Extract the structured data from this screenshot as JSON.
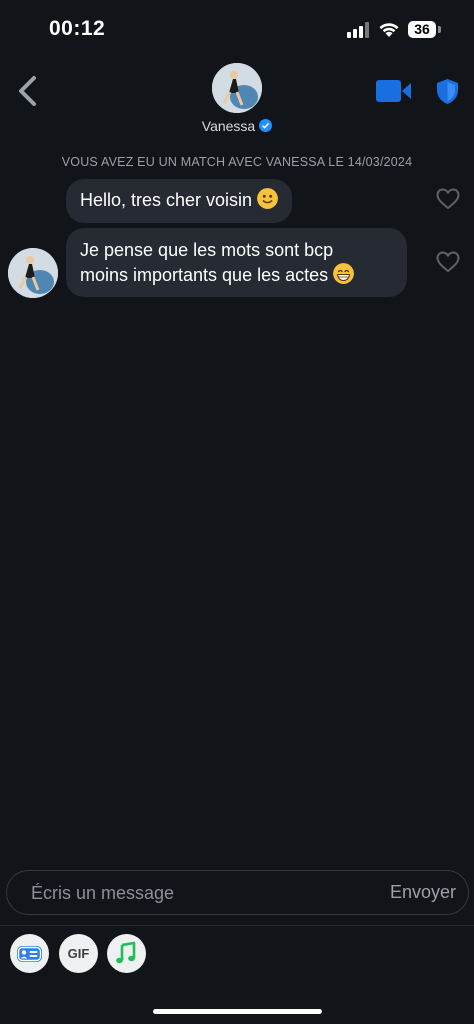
{
  "status": {
    "time": "00:12",
    "battery": "36"
  },
  "header": {
    "contact_name": "Vanessa"
  },
  "chat": {
    "match_notice": "VOUS AVEZ EU UN MATCH AVEC VANESSA LE 14/03/2024",
    "messages": [
      {
        "text": "Hello, tres cher voisin",
        "emoji": "slightly-smiling-face"
      },
      {
        "line1": "Je pense que les mots sont bcp",
        "line2": "moins importants que les actes",
        "emoji": "grinning-face"
      }
    ]
  },
  "composer": {
    "placeholder": "Écris un message",
    "send_label": "Envoyer"
  },
  "tools": {
    "gif_label": "GIF"
  },
  "colors": {
    "accent_blue": "#1a6fe0",
    "verified": "#1e90ff",
    "bubble": "#252a33",
    "background": "#111419"
  }
}
